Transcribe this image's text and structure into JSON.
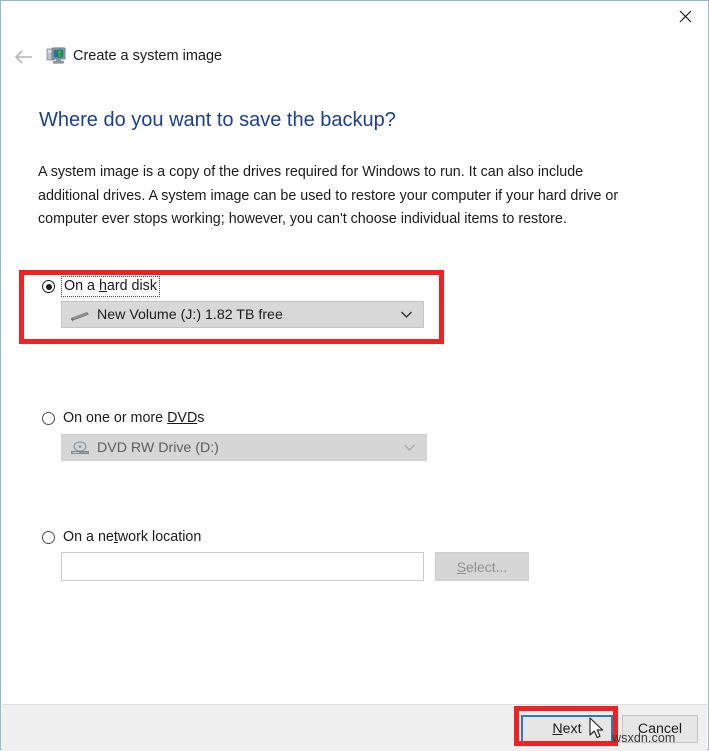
{
  "window": {
    "app_title": "Create a system image",
    "close_label": "Close",
    "back_label": "Back"
  },
  "page": {
    "heading": "Where do you want to save the backup?",
    "description": "A system image is a copy of the drives required for Windows to run. It can also include additional drives. A system image can be used to restore your computer if your hard drive or computer ever stops working; however, you can't choose individual items to restore."
  },
  "options": {
    "hard_disk": {
      "label_before": "On a ",
      "label_accel": "h",
      "label_after": "ard disk",
      "full_label": "On a hard disk",
      "selected": true,
      "combo_value": "New Volume (J:)  1.82 TB free",
      "drive_name": "New Volume (J:)",
      "free_space": "1.82 TB free",
      "icon": "hard-drive-icon",
      "enabled": true
    },
    "dvd": {
      "label_before": "On one or more ",
      "label_accel": "DVD",
      "label_after": "s",
      "full_label": "On one or more DVDs",
      "selected": false,
      "combo_value": "DVD RW Drive (D:)",
      "icon": "optical-drive-icon",
      "enabled": false
    },
    "network": {
      "label_before": "On a ne",
      "label_accel": "t",
      "label_after": "work location",
      "full_label": "On a network location",
      "selected": false,
      "path_value": "",
      "path_placeholder": "",
      "select_button_accel": "S",
      "select_button_after": "elect...",
      "select_button_label": "Select...",
      "enabled": false
    }
  },
  "footer": {
    "next_accel": "N",
    "next_after": "ext",
    "next_label": "Next",
    "cancel_label": "Cancel"
  },
  "watermark": {
    "text": "wsxdn.com"
  },
  "colors": {
    "heading": "#1c3f94",
    "annotation": "#ee2222",
    "focus_border": "#2a7ac4",
    "window_border": "#8cbcd6"
  }
}
